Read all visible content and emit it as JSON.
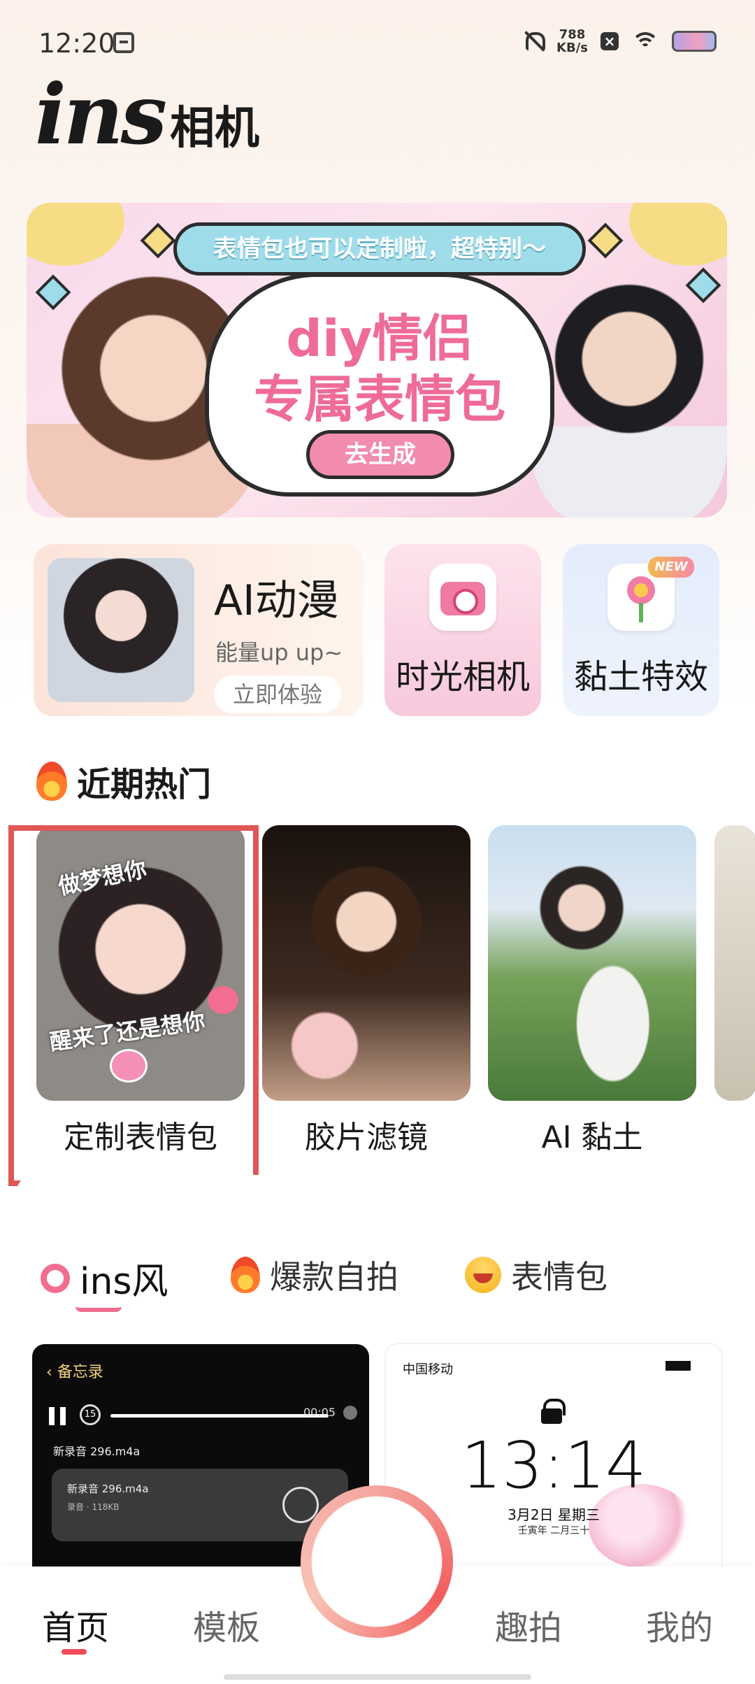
{
  "status_bar": {
    "time": "12:20",
    "net_speed_value": "788",
    "net_speed_unit": "KB/s",
    "x_badge": "×"
  },
  "header": {
    "logo_ins": "ins",
    "logo_cn": "相机"
  },
  "banner": {
    "pill_text": "表情包也可以定制啦，超特别～",
    "title_line1": "diy情侣",
    "title_line2": "专属表情包",
    "button": "去生成"
  },
  "features": {
    "anime": {
      "title": "AI动漫",
      "subtitle": "能量up up~",
      "button": "立即体验"
    },
    "time_camera": {
      "label": "时光相机"
    },
    "clay": {
      "label": "黏土特效",
      "badge": "NEW"
    }
  },
  "hot": {
    "title": "近期热门",
    "items": [
      {
        "label": "定制表情包",
        "sticker_top": "做梦想你",
        "sticker_bottom": "醒来了还是想你"
      },
      {
        "label": "胶片滤镜"
      },
      {
        "label": "AI 黏土"
      }
    ]
  },
  "categories": {
    "tabs": [
      {
        "label": "ins风",
        "icon": "circle-icon",
        "selected": true
      },
      {
        "label": "爆款自拍",
        "icon": "fire-icon"
      },
      {
        "label": "表情包",
        "icon": "smile-icon"
      }
    ],
    "accent_color": "#f26d8f"
  },
  "templates": {
    "memo": {
      "back_label": "备忘录",
      "rewind": "15",
      "duration": "00:05",
      "file_name": "新录音 296.m4a",
      "card_name": "新录音 296.m4a",
      "card_meta": "录音 · 118KB"
    },
    "lockscreen": {
      "carrier": "中国移动",
      "time": "13:14",
      "date": "3月2日 星期三",
      "lunar": "壬寅年 二月三十"
    }
  },
  "bottom_nav": {
    "items": [
      {
        "label": "首页",
        "active": true
      },
      {
        "label": "模板"
      },
      {
        "label": "趣拍"
      },
      {
        "label": "我的"
      }
    ],
    "active_color": "#f04a5a"
  }
}
